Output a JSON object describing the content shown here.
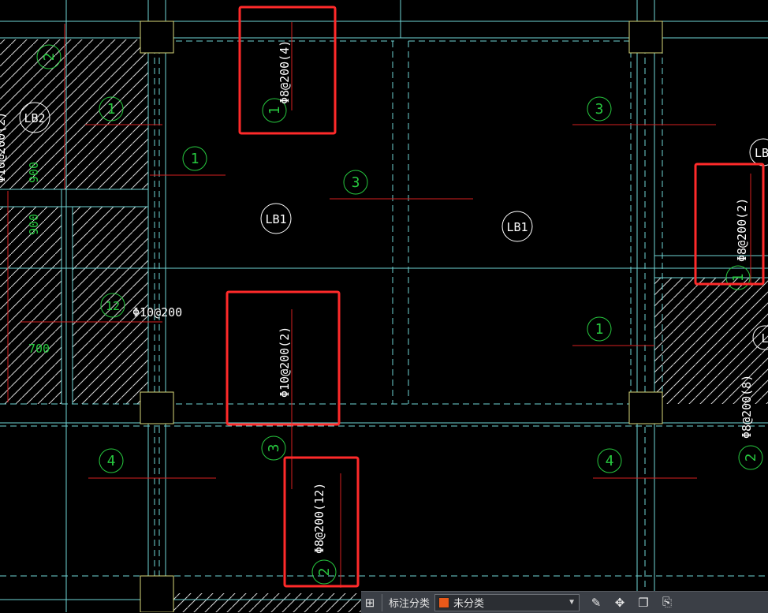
{
  "drawing": {
    "labels": [
      {
        "id": "circle-2-topleft",
        "text": "2"
      },
      {
        "id": "circle-1-a",
        "text": "1"
      },
      {
        "id": "circle-1-b",
        "text": "1"
      },
      {
        "id": "circle-1-c",
        "text": "1"
      },
      {
        "id": "circle-1-d",
        "text": "1"
      },
      {
        "id": "circle-1-e",
        "text": "1"
      },
      {
        "id": "circle-3-a",
        "text": "3"
      },
      {
        "id": "circle-3-b",
        "text": "3"
      },
      {
        "id": "circle-3-c",
        "text": "3"
      },
      {
        "id": "circle-4-a",
        "text": "4"
      },
      {
        "id": "circle-4-b",
        "text": "4"
      },
      {
        "id": "circle-12",
        "text": "12"
      },
      {
        "id": "circle-2-bottom",
        "text": "2"
      },
      {
        "id": "circle-2-right",
        "text": "2"
      }
    ],
    "slab_tags": [
      {
        "id": "lb2",
        "text": "LB2"
      },
      {
        "id": "lb1-left",
        "text": "LB1"
      },
      {
        "id": "lb1-right",
        "text": "LB1"
      },
      {
        "id": "lb-right-edge-top",
        "text": "LB"
      },
      {
        "id": "lb-right-edge-mid",
        "text": "L"
      }
    ],
    "rebar": {
      "r_top": "Φ8@200(4)",
      "r_right": "Φ8@200(2)",
      "r_mid": "Φ10@200(2)",
      "r_bottom": "Φ8@200(12)",
      "r_horizontal": "Φ10@200",
      "r_far_right": "Φ8@200(8)",
      "r_far_left": "Φ10@200(2)"
    },
    "dims": {
      "d900a": "900",
      "d900b": "900",
      "d700": "700"
    }
  },
  "toolbar": {
    "group_icon": "group-icon",
    "label": "标注分类",
    "category_value": "未分类",
    "category_color": "#e8591a",
    "icons": [
      "edit-icon",
      "move-icon",
      "copy-icon",
      "paste-icon"
    ]
  },
  "colors": {
    "background": "#000000",
    "grid_cyan": "#6fd6d6",
    "green": "#27c93f",
    "red_line": "#d62020",
    "highlight": "#ff2a2a",
    "white": "#ffffff",
    "column": "#d9d97a"
  }
}
